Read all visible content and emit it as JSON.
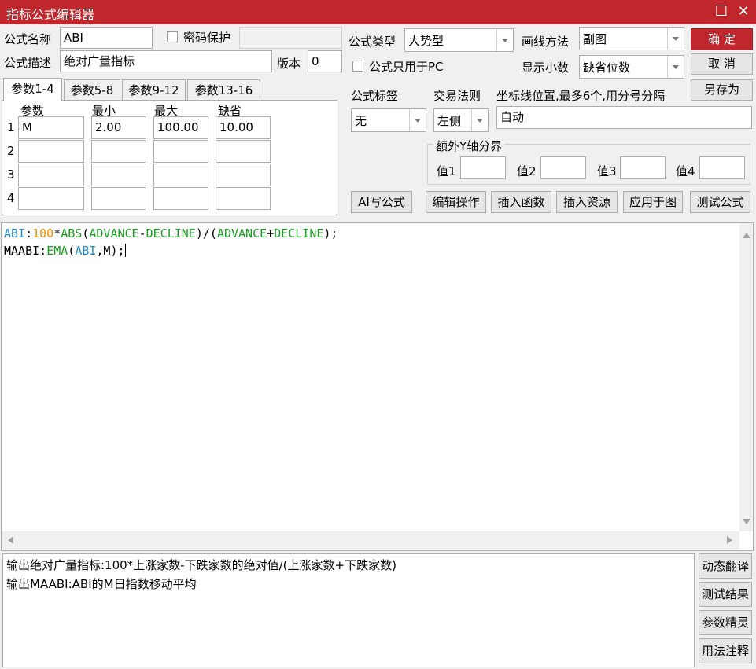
{
  "window": {
    "title": "指标公式编辑器",
    "restore_glyph": "☐",
    "close_glyph": "✕"
  },
  "form": {
    "name_label": "公式名称",
    "name_value": "ABI",
    "password_label": "密码保护",
    "desc_label": "公式描述",
    "desc_value": "绝对广量指标",
    "version_label": "版本",
    "version_value": "0",
    "type_label": "公式类型",
    "type_value": "大势型",
    "draw_label": "画线方法",
    "draw_value": "副图",
    "pc_only_label": "公式只用于PC",
    "decimal_label": "显示小数",
    "decimal_value": "缺省位数",
    "tag_label": "公式标签",
    "tag_value": "无",
    "trade_label": "交易法则",
    "trade_value": "左侧",
    "axis_label": "坐标线位置,最多6个,用分号分隔",
    "axis_value": "自动",
    "extra_y_label": "额外Y轴分界",
    "y_values": [
      "值1",
      "值2",
      "值3",
      "值4"
    ]
  },
  "buttons": {
    "ok": "确  定",
    "cancel": "取  消",
    "save_as": "另存为",
    "ai": "AI写公式",
    "edit_ops": "编辑操作",
    "insert_fn": "插入函数",
    "insert_res": "插入资源",
    "apply": "应用于图",
    "test": "测试公式"
  },
  "tabs": [
    "参数1-4",
    "参数5-8",
    "参数9-12",
    "参数13-16"
  ],
  "params": {
    "headers": [
      "参数",
      "最小",
      "最大",
      "缺省"
    ],
    "rows": [
      {
        "idx": "1",
        "name": "M",
        "min": "2.00",
        "max": "100.00",
        "def": "10.00"
      },
      {
        "idx": "2",
        "name": "",
        "min": "",
        "max": "",
        "def": ""
      },
      {
        "idx": "3",
        "name": "",
        "min": "",
        "max": "",
        "def": ""
      },
      {
        "idx": "4",
        "name": "",
        "min": "",
        "max": "",
        "def": ""
      }
    ]
  },
  "code": {
    "line1": [
      "ABI",
      ":",
      "100",
      "*",
      "ABS",
      "(",
      "ADVANCE",
      "-",
      "DECLINE",
      ")/(",
      "ADVANCE",
      "+",
      "DECLINE",
      ");"
    ],
    "line2": [
      "MAABI",
      ":",
      "EMA",
      "(",
      "ABI",
      ",M);"
    ]
  },
  "output": {
    "line1": "输出绝对广量指标:100*上涨家数-下跌家数的绝对值/(上涨家数+下跌家数)",
    "line2": "输出MAABI:ABI的M日指数移动平均"
  },
  "side_buttons": [
    "动态翻译",
    "测试结果",
    "参数精灵",
    "用法注释"
  ],
  "colors": {
    "title_bar": "#c0272d",
    "primary_button": "#c0272d",
    "code_var": "#1e88c8",
    "code_number": "#f08c00",
    "code_function": "#16a020"
  }
}
